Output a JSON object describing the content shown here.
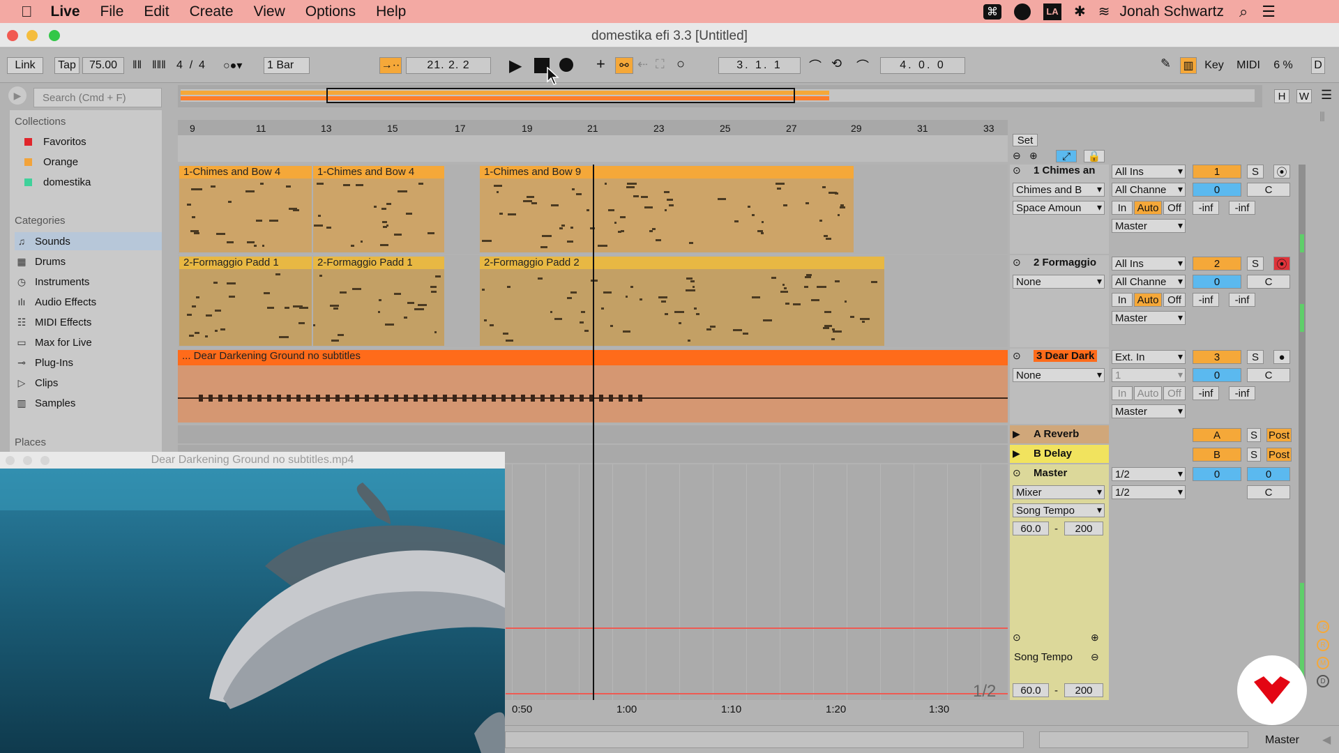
{
  "menubar": {
    "apple_icon": "apple-icon",
    "app": "Live",
    "items": [
      "File",
      "Edit",
      "Create",
      "View",
      "Options",
      "Help"
    ],
    "user": "Jonah Schwartz"
  },
  "window": {
    "title": "domestika efi 3.3  [Untitled]"
  },
  "transport": {
    "link": "Link",
    "tap": "Tap",
    "tempo": "75.00",
    "sig_num": "4",
    "sig_slash": "/",
    "sig_den": "4",
    "quantize": "1 Bar",
    "position": "21.  2.  2",
    "loop_start": "3.  1.  1",
    "loop_length": "4.  0.  0",
    "key": "Key",
    "midi": "MIDI",
    "cpu": "6 %",
    "d": "D"
  },
  "browser": {
    "search_placeholder": "Search (Cmd + F)",
    "collections_title": "Collections",
    "collections": [
      {
        "label": "Favoritos",
        "color": "#e0252b"
      },
      {
        "label": "Orange",
        "color": "#f2a33a"
      },
      {
        "label": "domestika",
        "color": "#3fd19a"
      }
    ],
    "categories_title": "Categories",
    "categories": [
      "Sounds",
      "Drums",
      "Instruments",
      "Audio Effects",
      "MIDI Effects",
      "Max for Live",
      "Plug-Ins",
      "Clips",
      "Samples"
    ],
    "places_title": "Places"
  },
  "ruler": {
    "bars": [
      "9",
      "11",
      "13",
      "15",
      "17",
      "19",
      "21",
      "23",
      "25",
      "27",
      "29",
      "31",
      "33"
    ],
    "set": "Set"
  },
  "tracks": [
    {
      "name": "1 Chimes an",
      "clips": [
        "1-Chimes and Bow 4",
        "1-Chimes and Bow 4",
        "1-Chimes and Bow 9"
      ],
      "device": "Chimes and B",
      "param": "Space Amoun",
      "input": "All Ins",
      "channel": "All Channe",
      "output": "Master",
      "num": "1",
      "vol": "0",
      "pan": "C"
    },
    {
      "name": "2 Formaggio",
      "clips": [
        "2-Formaggio Padd 1",
        "2-Formaggio Padd 1",
        "2-Formaggio Padd 2"
      ],
      "device": "None",
      "input": "All Ins",
      "channel": "All Channe",
      "output": "Master",
      "num": "2",
      "vol": "0",
      "pan": "C"
    },
    {
      "name": "3 Dear Dark",
      "clips": [
        "... Dear Darkening Ground no subtitles"
      ],
      "device": "None",
      "input": "Ext. In",
      "channel": "1",
      "output": "Master",
      "num": "3",
      "vol": "0",
      "pan": "C"
    }
  ],
  "monitor": {
    "in": "In",
    "auto": "Auto",
    "off": "Off",
    "inf": "-inf",
    "s": "S"
  },
  "returns": [
    {
      "name": "A Reverb",
      "letter": "A",
      "post": "Post"
    },
    {
      "name": "B Delay",
      "letter": "B",
      "post": "Post"
    }
  ],
  "master": {
    "name": "Master",
    "out1": "1/2",
    "out2": "1/2",
    "vol": "0",
    "vol2": "0",
    "pan": "C",
    "mixer": "Mixer",
    "song_tempo": "Song Tempo",
    "tempo_min": "60.0",
    "tempo_dash": "-",
    "tempo_max": "200",
    "fraction": "1/2"
  },
  "time_ruler": [
    "0:50",
    "1:00",
    "1:10",
    "1:20",
    "1:30"
  ],
  "bottom": {
    "master": "Master"
  },
  "video": {
    "title": "Dear Darkening Ground no subtitles.mp4"
  }
}
